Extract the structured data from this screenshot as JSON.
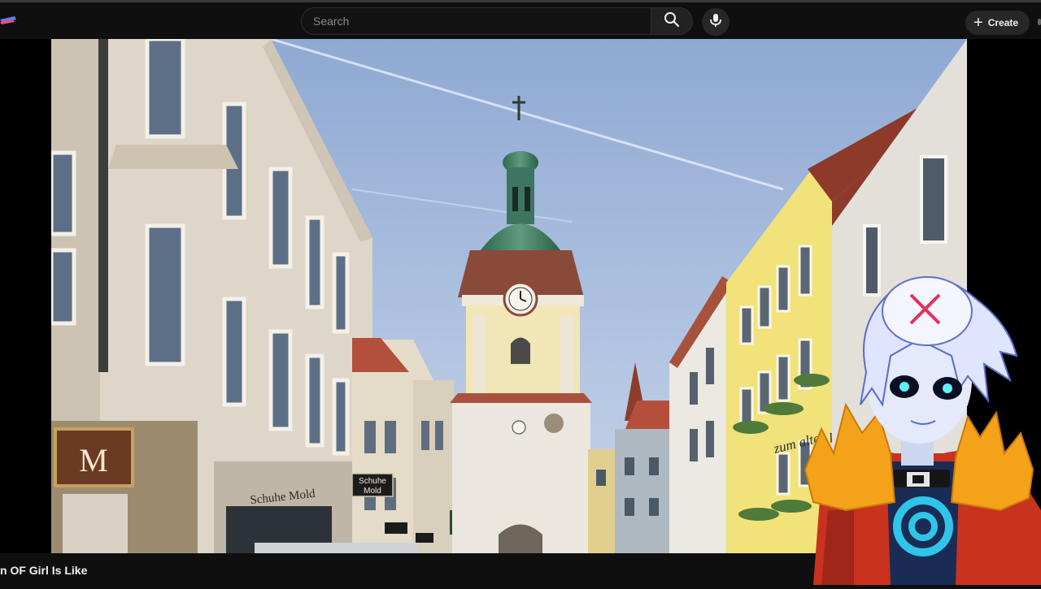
{
  "header": {
    "search": {
      "placeholder": "Search",
      "value": ""
    },
    "create_label": "Create",
    "icons": {
      "search": "search-icon",
      "mic": "microphone-icon",
      "plus": "plus-icon",
      "logo": "logo-icon"
    }
  },
  "video": {
    "title": "n OF Girl Is Like",
    "signs": {
      "shoe_store": [
        "Schuhe",
        "Mold"
      ],
      "shop_facade": "Schuhe Mold",
      "hotel": "zum alten post",
      "store_logo": "M"
    }
  },
  "colors": {
    "background": "#0f0f0f",
    "sky": "#a8bfde",
    "tower": "#ece9e2",
    "dome": "#3f7d62",
    "yellow_building": "#f1e27a",
    "avatar_jacket": "#c8321f",
    "avatar_fur": "#f3a21a",
    "avatar_hair": "#dfe4ff"
  }
}
